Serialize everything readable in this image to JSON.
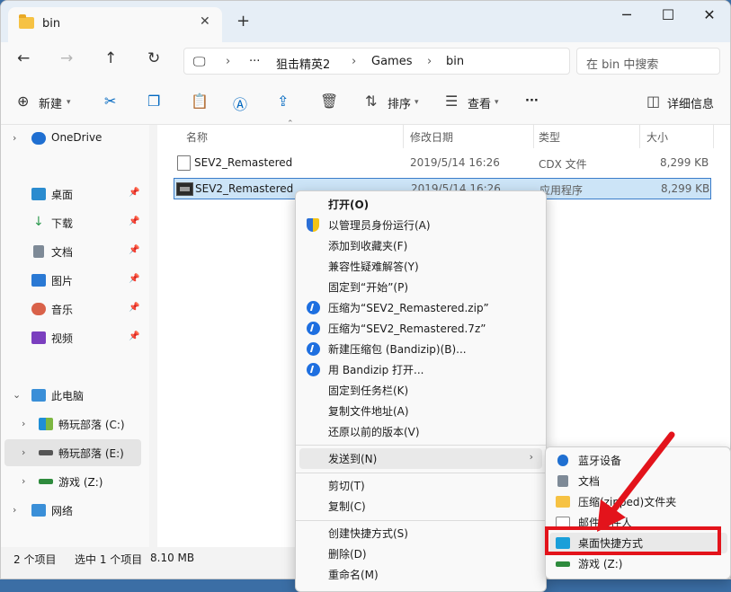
{
  "window": {
    "tab_title": "bin",
    "close_glyph": "✕",
    "newtab_glyph": "+",
    "minimize_glyph": "─",
    "maximize_glyph": "☐",
    "close_window_glyph": "✕"
  },
  "address": {
    "more": "···",
    "crumbs": [
      "狙击精英2",
      "Games",
      "bin"
    ],
    "sep": "›",
    "search_placeholder": "在 bin 中搜索"
  },
  "toolbar": {
    "new_label": "新建",
    "sort_label": "排序",
    "view_label": "查看",
    "more": "···",
    "details_label": "详细信息"
  },
  "sidebar": {
    "onedrive": "OneDrive",
    "quick": [
      "桌面",
      "下载",
      "文档",
      "图片",
      "音乐",
      "视频"
    ],
    "pc": "此电脑",
    "drives": [
      "畅玩部落 (C:)",
      "畅玩部落 (E:)",
      "游戏 (Z:)"
    ],
    "network": "网络"
  },
  "columns": {
    "name": "名称",
    "date": "修改日期",
    "type": "类型",
    "size": "大小"
  },
  "files": [
    {
      "name": "SEV2_Remastered",
      "date": "2019/5/14 16:26",
      "type": "CDX 文件",
      "size": "8,299 KB"
    },
    {
      "name": "SEV2_Remastered",
      "date": "2019/5/14 16:26",
      "type": "应用程序",
      "size": "8,299 KB"
    }
  ],
  "status": {
    "count": "2 个项目",
    "selected": "选中 1 个项目",
    "size": "8.10 MB"
  },
  "context_menu": {
    "open": "打开(O)",
    "run_admin": "以管理员身份运行(A)",
    "add_fav": "添加到收藏夹(F)",
    "compat": "兼容性疑难解答(Y)",
    "pin_start": "固定到“开始”(P)",
    "zip": "压缩为“SEV2_Remastered.zip”",
    "sevenz": "压缩为“SEV2_Remastered.7z”",
    "new_archive": "新建压缩包 (Bandizip)(B)...",
    "open_bandizip": "用 Bandizip 打开...",
    "pin_taskbar": "固定到任务栏(K)",
    "copy_path": "复制文件地址(A)",
    "restore": "还原以前的版本(V)",
    "send_to": "发送到(N)",
    "cut": "剪切(T)",
    "copy": "复制(C)",
    "shortcut": "创建快捷方式(S)",
    "delete": "删除(D)",
    "rename": "重命名(M)"
  },
  "submenu": {
    "bluetooth": "蓝牙设备",
    "documents": "文档",
    "zip_folder": "压缩(zipped)文件夹",
    "mail": "邮件收件人",
    "desktop_shortcut": "桌面快捷方式",
    "game_drive": "游戏 (Z:)"
  },
  "colors": {
    "accent": "#0067c0",
    "highlight": "#e3131b"
  }
}
